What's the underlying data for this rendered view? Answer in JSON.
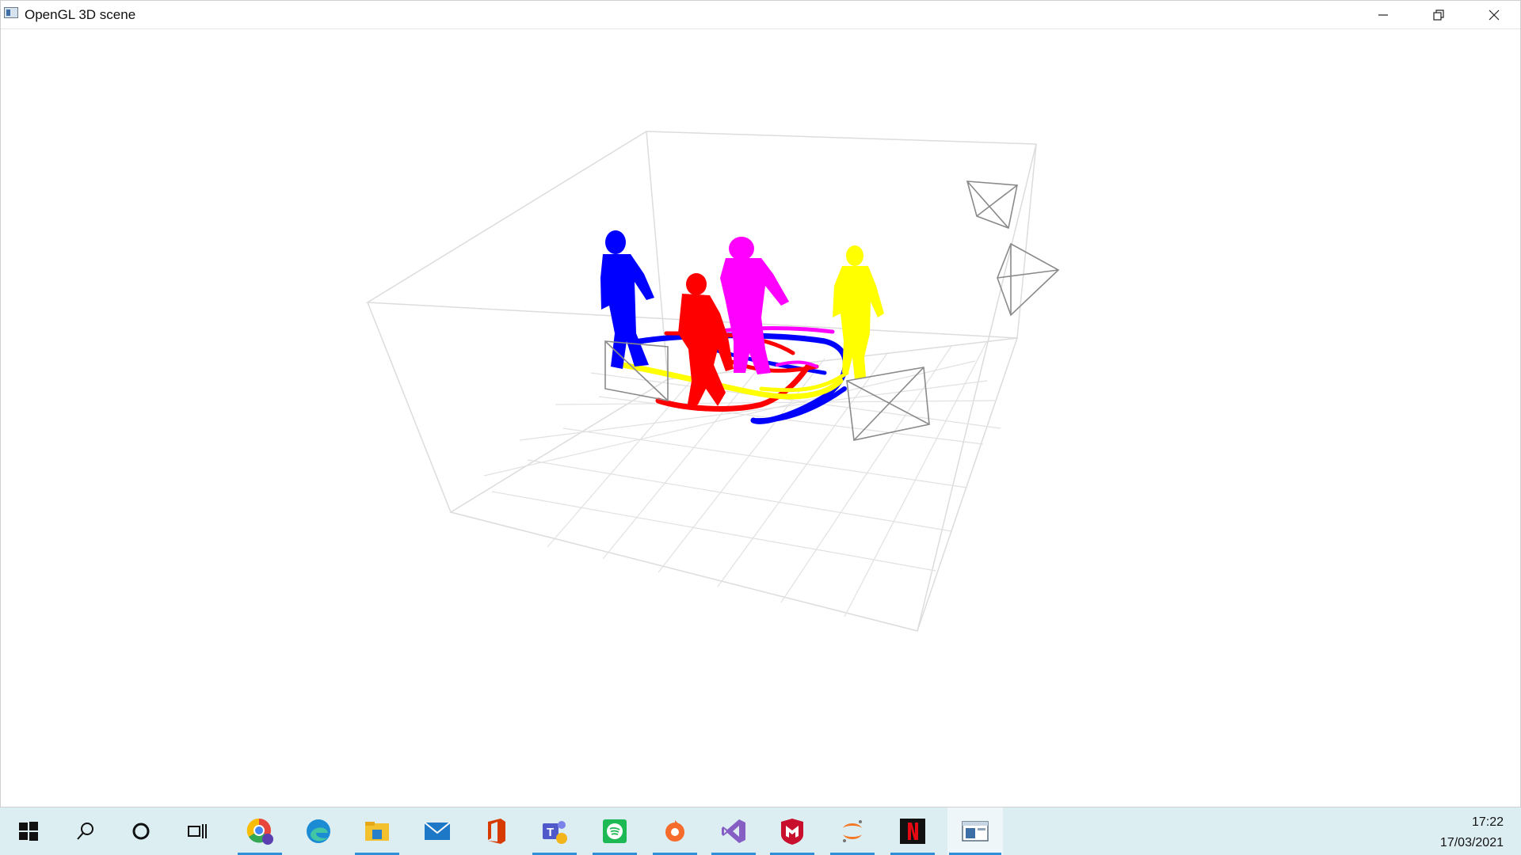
{
  "window": {
    "title": "OpenGL 3D scene",
    "controls": [
      "minimize",
      "restore",
      "close"
    ]
  },
  "scene": {
    "people_colors": [
      "#0000ff",
      "#ff00ff",
      "#ff0000",
      "#ffff00"
    ],
    "trail_colors": [
      "#0000ff",
      "#ff0000",
      "#ffff00",
      "#ff00ff"
    ],
    "grid_color": "#dcdcdc",
    "camera_color": "#8a8a8a"
  },
  "taskbar": {
    "icons": [
      {
        "name": "start-icon"
      },
      {
        "name": "search-icon"
      },
      {
        "name": "cortana-icon"
      },
      {
        "name": "task-view-icon"
      },
      {
        "name": "chrome-icon"
      },
      {
        "name": "edge-icon"
      },
      {
        "name": "file-explorer-icon"
      },
      {
        "name": "mail-icon"
      },
      {
        "name": "office-icon"
      },
      {
        "name": "teams-icon"
      },
      {
        "name": "spotify-icon"
      },
      {
        "name": "origin-icon"
      },
      {
        "name": "visual-studio-icon"
      },
      {
        "name": "mcafee-icon"
      },
      {
        "name": "jupyter-icon"
      },
      {
        "name": "netflix-icon"
      },
      {
        "name": "opengl-window-icon"
      }
    ],
    "clock": {
      "time": "17:22",
      "date": "17/03/2021"
    }
  }
}
